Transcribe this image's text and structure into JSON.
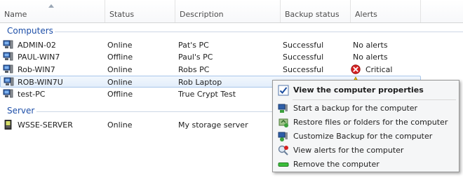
{
  "columns": {
    "name": "Name",
    "status": "Status",
    "description": "Description",
    "backup_status": "Backup status",
    "alerts": "Alerts"
  },
  "groups": {
    "computers": "Computers",
    "server": "Server"
  },
  "rows": [
    {
      "name": "ADMIN-02",
      "status": "Online",
      "description": "Pat's PC",
      "backup": "Successful",
      "alert": "No alerts"
    },
    {
      "name": "PAUL-WIN7",
      "status": "Offline",
      "description": "Paul's PC",
      "backup": "Successful",
      "alert": "No alerts"
    },
    {
      "name": "Rob-WIN7",
      "status": "Online",
      "description": "Robs PC",
      "backup": "Successful",
      "alert": "Critical"
    },
    {
      "name": "ROB-WIN7U",
      "status": "Online",
      "description": "Rob Laptop",
      "backup": "",
      "alert": ""
    },
    {
      "name": "test-PC",
      "status": "Offline",
      "description": "True Crypt Test",
      "backup": "",
      "alert": ""
    },
    {
      "name": "WSSE-SERVER",
      "status": "Online",
      "description": "My storage server",
      "backup": "",
      "alert": ""
    }
  ],
  "context_menu": {
    "view_properties": "View the computer properties",
    "start_backup": "Start a backup for the computer",
    "restore_files": "Restore files or folders for the computer",
    "customize_backup": "Customize Backup for the computer",
    "view_alerts": "View alerts for the computer",
    "remove": "Remove the computer"
  },
  "icons": {
    "computer": "computer-icon",
    "server": "server-icon",
    "critical": "critical-alert-icon",
    "warning": "warning-alert-icon"
  },
  "colors": {
    "group_label": "#1e4fa8",
    "selection": "#e3eefb",
    "critical": "#d62020",
    "warning": "#f2c200"
  }
}
